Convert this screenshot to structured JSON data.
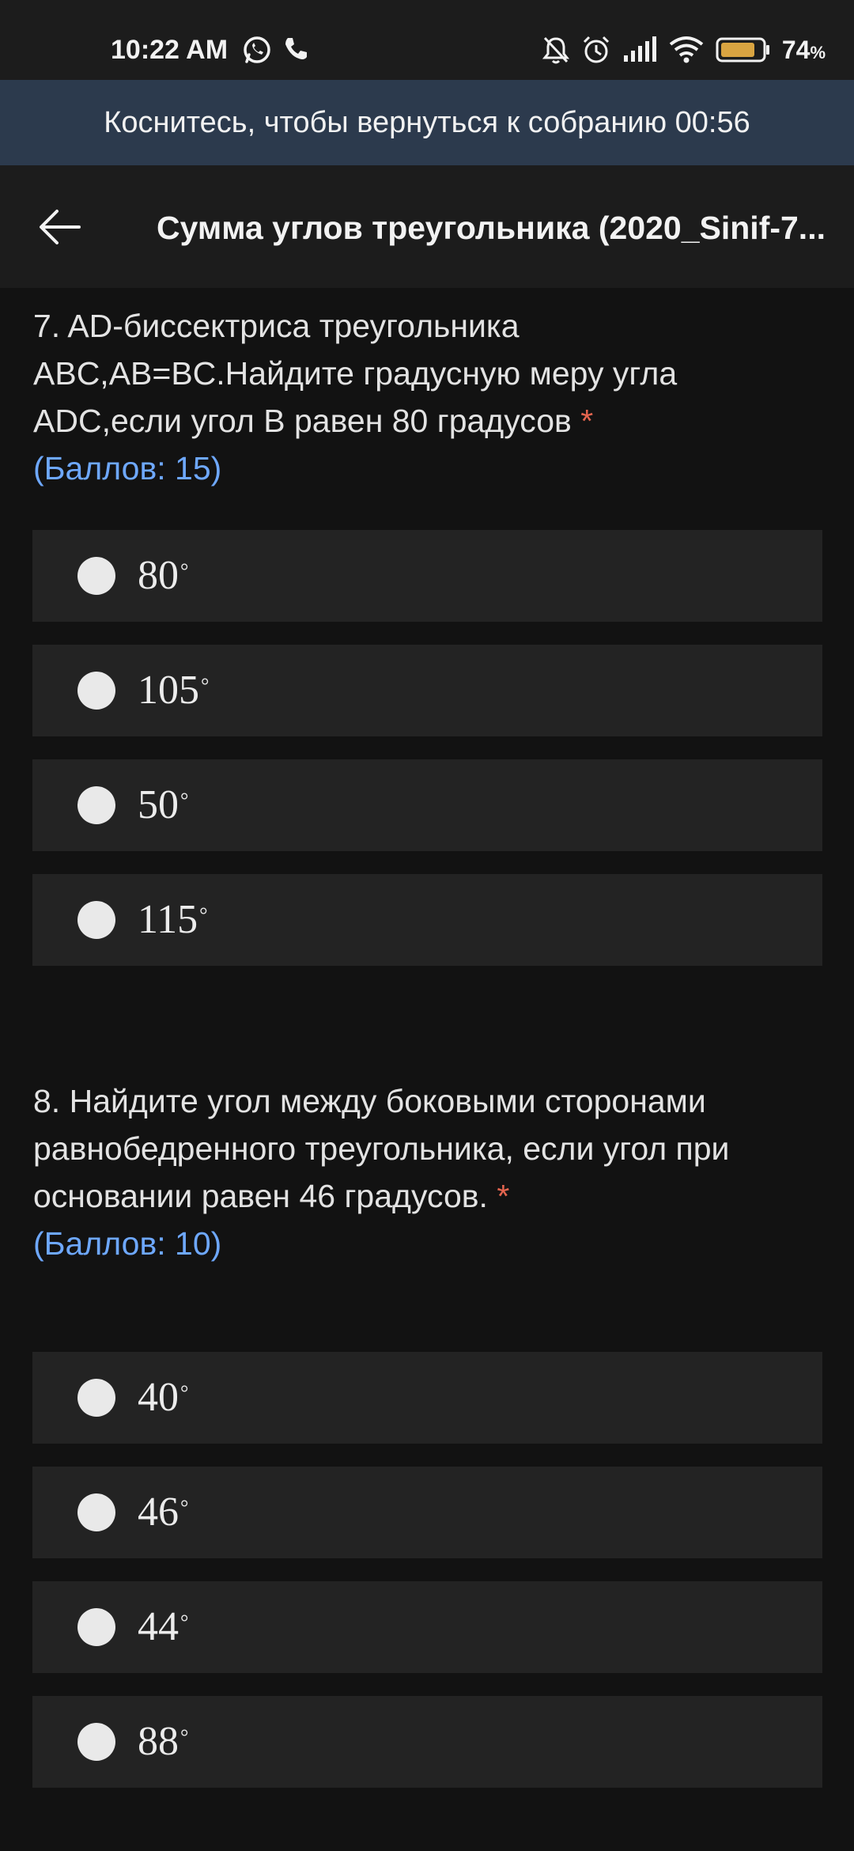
{
  "status_bar": {
    "time": "10:22 AM",
    "left_icons": [
      "whatsapp-icon",
      "phone-icon"
    ],
    "right_icons": [
      "mute-bell-icon",
      "alarm-icon",
      "signal-icon",
      "wifi-icon",
      "battery-icon"
    ],
    "battery_percent": "74",
    "battery_unit": "%"
  },
  "banner": {
    "text": "Коснитесь, чтобы вернуться к собранию 00:56"
  },
  "app_bar": {
    "back_icon": "arrow-left-icon",
    "title": "Сумма углов треугольника (2020_Sinif-7..."
  },
  "questions": [
    {
      "text": "7. AD-биссектриса треугольника ABC,AB=BC.Найдите градусную меру угла ADC,если угол B равен 80 градусов",
      "required": "*",
      "points": "(Баллов: 15)",
      "options": [
        {
          "value": "80",
          "unit": "°"
        },
        {
          "value": "105",
          "unit": "°"
        },
        {
          "value": "50",
          "unit": "°"
        },
        {
          "value": "115",
          "unit": "°"
        }
      ]
    },
    {
      "text": "8. Найдите угол между боковыми сторонами равнобедренного треугольника, если угол при основании равен 46 градусов.",
      "required": "*",
      "points": "(Баллов: 10)",
      "options": [
        {
          "value": "40",
          "unit": "°"
        },
        {
          "value": "46",
          "unit": "°"
        },
        {
          "value": "44",
          "unit": "°"
        },
        {
          "value": "88",
          "unit": "°"
        }
      ]
    }
  ],
  "colors": {
    "background": "#121212",
    "banner": "#2c3a4d",
    "option_bg": "#232323",
    "points": "#6ea8ff",
    "required": "#e5654f",
    "battery_fill": "#d9a441"
  }
}
